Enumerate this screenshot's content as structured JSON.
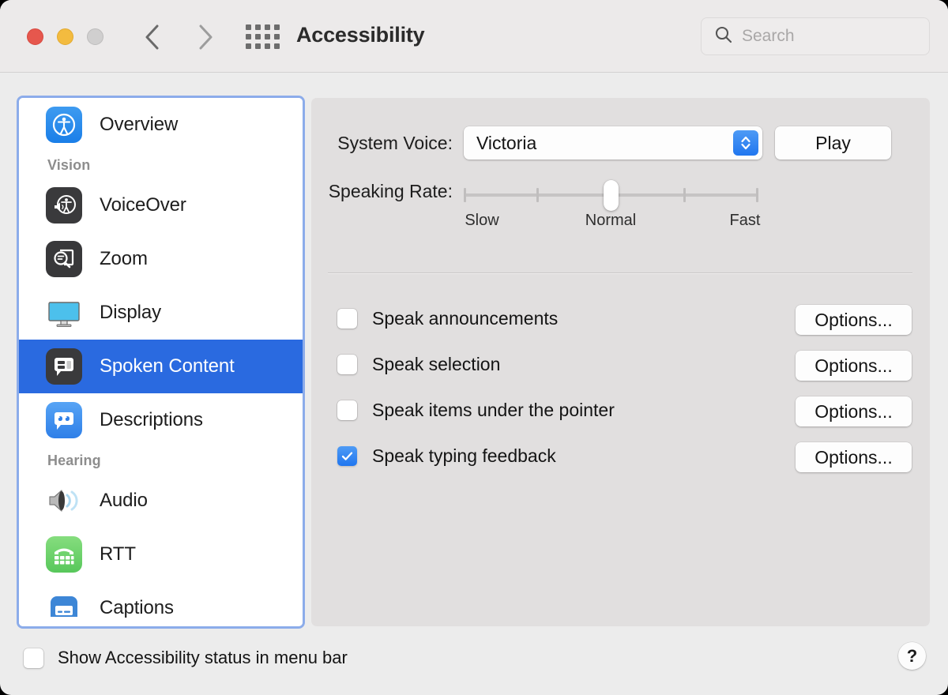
{
  "window": {
    "title": "Accessibility",
    "traffic_lights": [
      {
        "name": "close",
        "color": "#e6574d"
      },
      {
        "name": "minimize",
        "color": "#f3bb3f"
      },
      {
        "name": "maximize",
        "color": "#d0cfcf"
      }
    ],
    "nav": {
      "back_icon": "chevron-left-icon",
      "forward_icon": "chevron-right-icon"
    },
    "grid_icon": "show-all-preferences-icon"
  },
  "search": {
    "placeholder": "Search",
    "value": "",
    "icon": "search-icon"
  },
  "sidebar": {
    "selected": "Spoken Content",
    "items": [
      {
        "type": "item",
        "label": "Overview",
        "icon": "accessibility-icon",
        "style": "blue"
      },
      {
        "type": "group",
        "label": "Vision"
      },
      {
        "type": "item",
        "label": "VoiceOver",
        "icon": "voiceover-icon",
        "style": "dark"
      },
      {
        "type": "item",
        "label": "Zoom",
        "icon": "zoom-magnifier-icon",
        "style": "dark2"
      },
      {
        "type": "item",
        "label": "Display",
        "icon": "display-monitor-icon",
        "style": "plain"
      },
      {
        "type": "item",
        "label": "Spoken Content",
        "icon": "spoken-content-icon",
        "style": "dark"
      },
      {
        "type": "item",
        "label": "Descriptions",
        "icon": "descriptions-icon",
        "style": "descr"
      },
      {
        "type": "group",
        "label": "Hearing"
      },
      {
        "type": "item",
        "label": "Audio",
        "icon": "audio-speaker-icon",
        "style": "plain"
      },
      {
        "type": "item",
        "label": "RTT",
        "icon": "rtt-teletype-icon",
        "style": "green"
      },
      {
        "type": "item",
        "label": "Captions",
        "icon": "captions-icon",
        "style": "cap"
      }
    ]
  },
  "main": {
    "system_voice": {
      "label": "System Voice:",
      "value": "Victoria",
      "stepper_icon": "chevron-up-down-icon",
      "play_label": "Play"
    },
    "speaking_rate": {
      "label": "Speaking Rate:",
      "marks": [
        "Slow",
        "Normal",
        "Fast"
      ],
      "thumb_percent": 50,
      "tick_percents": [
        0,
        25,
        50,
        75,
        100
      ]
    },
    "checkboxes": [
      {
        "label": "Speak announcements",
        "checked": false,
        "button": "Options..."
      },
      {
        "label": "Speak selection",
        "checked": false,
        "button": "Options..."
      },
      {
        "label": "Speak items under the pointer",
        "checked": false,
        "button": "Options..."
      },
      {
        "label": "Speak typing feedback",
        "checked": true,
        "button": "Options..."
      }
    ]
  },
  "footer": {
    "status_checkbox": {
      "label": "Show Accessibility status in menu bar",
      "checked": false
    },
    "help_label": "?"
  },
  "colors": {
    "accent_blue": "#2a6ae0",
    "control_blue": "#2076ef",
    "focus_ring": "#8cacea",
    "window_bg": "#ececec",
    "panel_bg": "#e1dfdf"
  }
}
